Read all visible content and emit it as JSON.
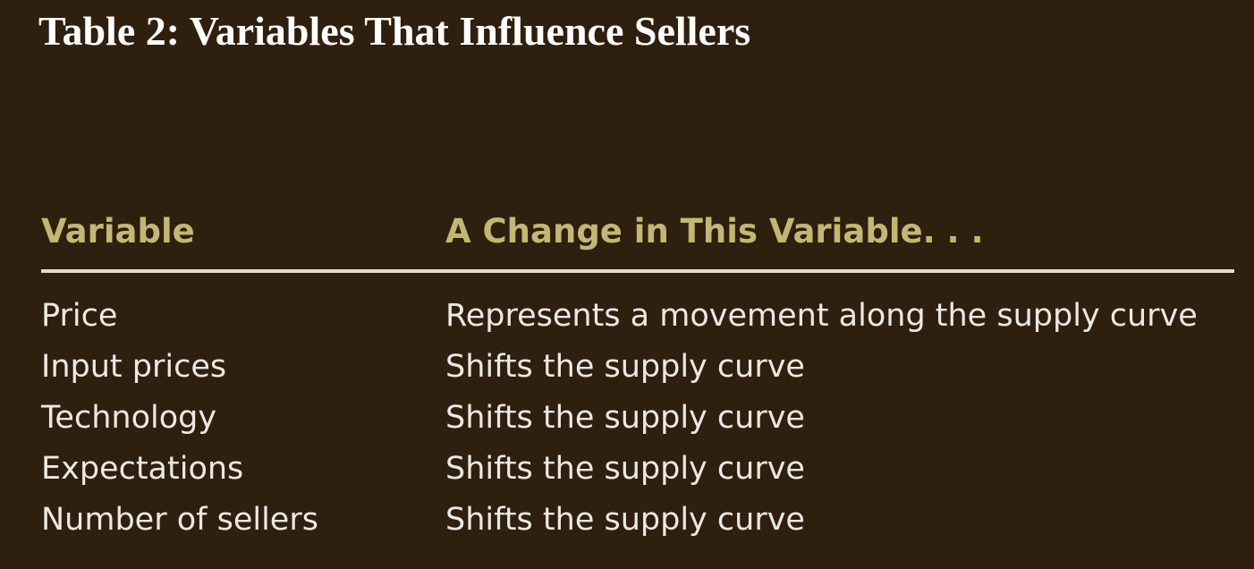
{
  "title": "Table 2: Variables That Influence Sellers",
  "table": {
    "headers": [
      "Variable",
      "A Change in This Variable. . ."
    ],
    "rows": [
      [
        "Price",
        "Represents a movement along the supply curve"
      ],
      [
        "Input prices",
        "Shifts the supply curve"
      ],
      [
        "Technology",
        "Shifts the supply curve"
      ],
      [
        "Expectations",
        "Shifts the supply curve"
      ],
      [
        "Number of sellers",
        "Shifts the supply curve"
      ]
    ]
  },
  "colors": {
    "background": "#2f1f0e",
    "title": "#ffffff",
    "header_text": "#c0b874",
    "body_text": "#ece8e3",
    "rule": "#e2ddd6"
  }
}
